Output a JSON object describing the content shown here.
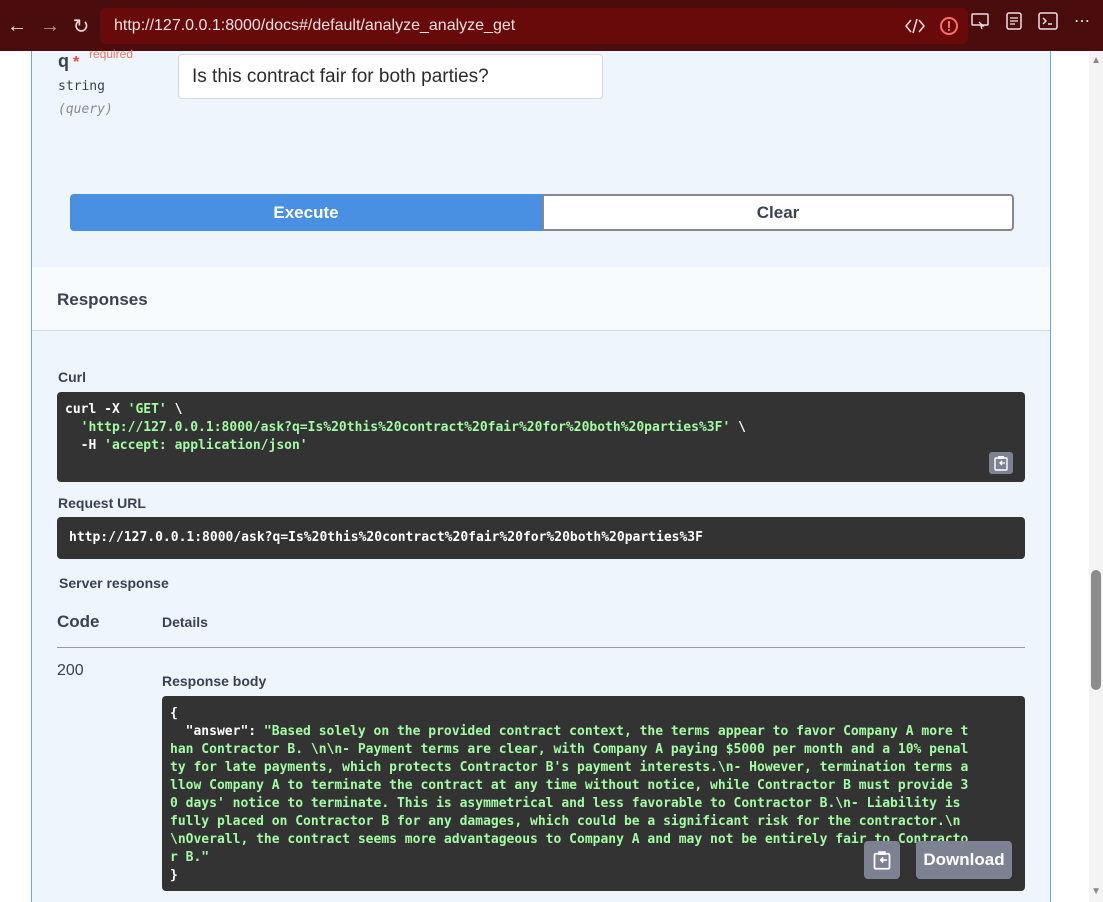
{
  "browser": {
    "url": "http://127.0.0.1:8000/docs#/default/analyze_analyze_get"
  },
  "param": {
    "name": "q",
    "star": "*",
    "required": "required",
    "type": "string",
    "in": "(query)",
    "value": "Is this contract fair for both parties?"
  },
  "buttons": {
    "execute": "Execute",
    "clear": "Clear"
  },
  "responses": {
    "title": "Responses",
    "curl_label": "Curl",
    "curl_lines": [
      {
        "plain": "curl -X ",
        "str": "'GET'",
        "tail": " \\"
      },
      {
        "plain": "  ",
        "str": "'http://127.0.0.1:8000/ask?q=Is%20this%20contract%20fair%20for%20both%20parties%3F'",
        "tail": " \\"
      },
      {
        "plain": "  -H ",
        "str": "'accept: application/json'",
        "tail": ""
      }
    ],
    "request_url_label": "Request URL",
    "request_url": "http://127.0.0.1:8000/ask?q=Is%20this%20contract%20fair%20for%20both%20parties%3F",
    "server_response_label": "Server response",
    "code_header": "Code",
    "details_header": "Details",
    "code": "200",
    "body_label": "Response body",
    "body_open": "{",
    "body_key": "  \"answer\": ",
    "body_lines": [
      "\"Based solely on the provided contract context, the terms appear to favor Company A more t",
      "han Contractor B. \\n\\n- Payment terms are clear, with Company A paying $5000 per month and a 10% penal",
      "ty for late payments, which protects Contractor B's payment interests.\\n- However, termination terms a",
      "llow Company A to terminate the contract at any time without notice, while Contractor B must provide 3",
      "0 days' notice to terminate. This is asymmetrical and less favorable to Contractor B.\\n- Liability is",
      "fully placed on Contractor B for any damages, which could be a significant risk for the contractor.\\n",
      "\\nOverall, the contract seems more advantageous to Company A and may not be entirely fair to Contracto",
      "r B.\""
    ],
    "body_close": "}",
    "download": "Download"
  }
}
